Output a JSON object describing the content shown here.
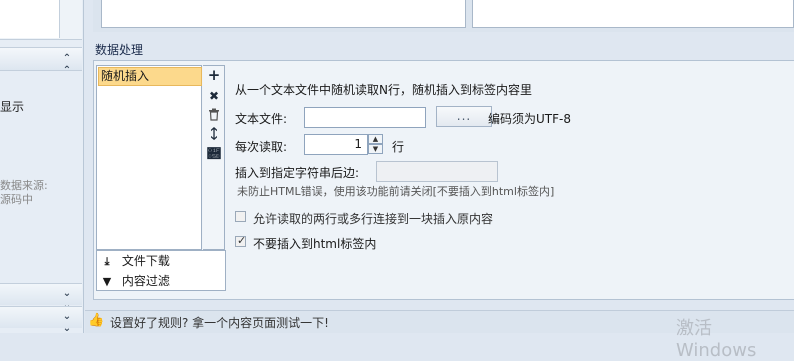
{
  "left": {
    "label_display": "显示",
    "label_source_1": "数据来源:",
    "label_source_2": "源码中"
  },
  "group": {
    "title": "数据处理",
    "list_items": [
      "随机插入"
    ],
    "side_tabs": [
      {
        "label": "文件下载",
        "icon": "download-icon"
      },
      {
        "label": "内容过滤",
        "icon": "filter-icon"
      }
    ]
  },
  "form": {
    "description": "从一个文本文件中随机读取N行，随机插入到标签内容里",
    "file_label": "文本文件:",
    "file_value": "",
    "browse_label": "...",
    "encoding_note": "编码须为UTF-8",
    "read_label": "每次读取:",
    "read_value": "1",
    "read_unit": "行",
    "insert_after_label": "插入到指定字符串后边:",
    "insert_after_value": "",
    "hint": "未防止HTML错误，使用该功能前请关闭[不要插入到html标签内]",
    "option_merge": {
      "label": "允许读取的两行或多行连接到一块插入原内容",
      "checked": false
    },
    "option_no_html": {
      "label": "不要插入到html标签内",
      "checked": true
    }
  },
  "footer": {
    "hint": "设置好了规则? 拿一个内容页面测试一下!"
  },
  "watermark": "激活 Windows"
}
